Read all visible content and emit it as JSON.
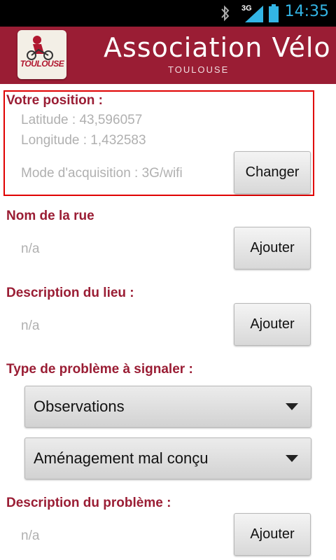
{
  "status_bar": {
    "network": "3G",
    "time": "14:35",
    "icons": [
      "bluetooth-icon",
      "signal-icon",
      "battery-icon"
    ]
  },
  "header": {
    "logo_text": "TOULOUSE",
    "title": "Association Vélo",
    "subtitle": "TOULOUSE",
    "brand_color": "#9a1d34"
  },
  "position": {
    "label": "Votre position :",
    "latitude": "Latitude : 43,596057",
    "longitude": "Longitude : 1,432583",
    "mode": "Mode d'acquisition : 3G/wifi",
    "change_button": "Changer"
  },
  "street": {
    "label": "Nom de la rue",
    "value": "n/a",
    "add_button": "Ajouter"
  },
  "place": {
    "label": "Description du lieu :",
    "value": "n/a",
    "add_button": "Ajouter"
  },
  "problem_type": {
    "label": "Type de problème à signaler :",
    "category": "Observations",
    "subcategory": "Aménagement mal conçu"
  },
  "problem_description": {
    "label": "Description du problème :",
    "value": "n/a",
    "add_button": "Ajouter"
  }
}
